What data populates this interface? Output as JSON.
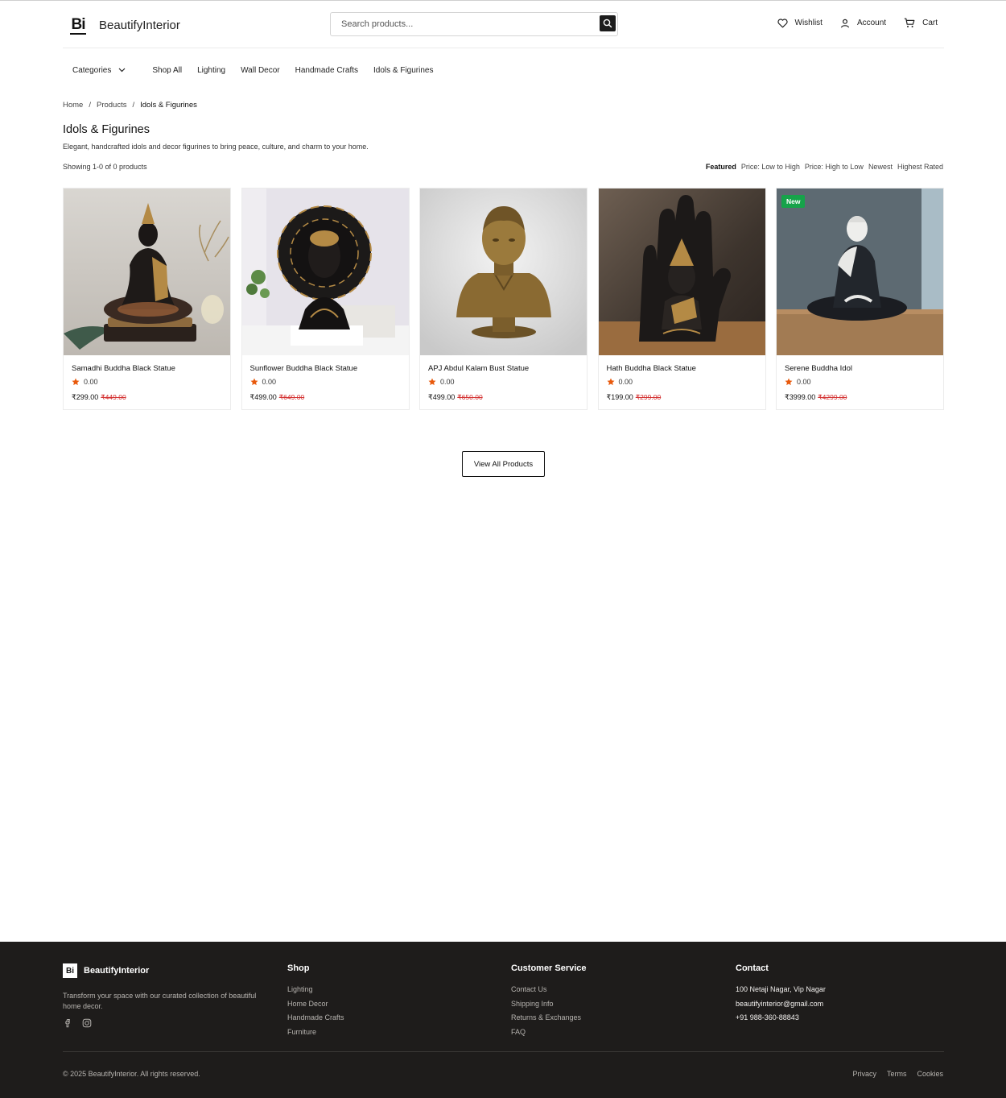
{
  "header": {
    "logo_mark": "Bi",
    "brand": "BeautifyInterior",
    "search_placeholder": "Search products...",
    "wishlist": "Wishlist",
    "account": "Account",
    "cart": "Cart"
  },
  "nav": {
    "categories": "Categories",
    "links": [
      "Shop All",
      "Lighting",
      "Wall Decor",
      "Handmade Crafts",
      "Idols & Figurines"
    ]
  },
  "breadcrumb": {
    "home": "Home",
    "sep": "/",
    "products": "Products",
    "current": "Idols & Figurines"
  },
  "page": {
    "title": "Idols & Figurines",
    "description": "Elegant, handcrafted idols and decor figurines to bring peace, culture, and charm to your home.",
    "showing": "Showing 1-0 of 0 products",
    "sort_options": [
      "Featured",
      "Price: Low to High",
      "Price: High to Low",
      "Newest",
      "Highest Rated"
    ]
  },
  "products": [
    {
      "name": "Samadhi Buddha Black Statue",
      "rating": "0.00",
      "price": "₹299.00",
      "old_price": "₹449.00",
      "badge": ""
    },
    {
      "name": "Sunflower Buddha Black Statue",
      "rating": "0.00",
      "price": "₹499.00",
      "old_price": "₹649.00",
      "badge": ""
    },
    {
      "name": "APJ Abdul Kalam Bust Statue",
      "rating": "0.00",
      "price": "₹499.00",
      "old_price": "₹650.00",
      "badge": ""
    },
    {
      "name": "Hath Buddha Black Statue",
      "rating": "0.00",
      "price": "₹199.00",
      "old_price": "₹299.00",
      "badge": ""
    },
    {
      "name": "Serene Buddha Idol",
      "rating": "0.00",
      "price": "₹3999.00",
      "old_price": "₹4299.00",
      "badge": "New"
    }
  ],
  "view_all": "View All Products",
  "footer": {
    "logo_mark": "Bi",
    "brand": "BeautifyInterior",
    "tagline": "Transform your space with our curated collection of beautiful home decor.",
    "shop_heading": "Shop",
    "shop_links": [
      "Lighting",
      "Home Decor",
      "Handmade Crafts",
      "Furniture"
    ],
    "service_heading": "Customer Service",
    "service_links": [
      "Contact Us",
      "Shipping Info",
      "Returns & Exchanges",
      "FAQ"
    ],
    "contact_heading": "Contact",
    "contact_lines": [
      "100 Netaji Nagar, Vip Nagar",
      "beautifyinterior@gmail.com",
      "+91 988-360-88843"
    ],
    "copyright": "© 2025 BeautifyInterior. All rights reserved.",
    "legal": [
      "Privacy",
      "Terms",
      "Cookies"
    ]
  },
  "colors": {
    "accent_star": "#e8590c",
    "old_price": "#d32f2f",
    "badge_new": "#16a34a",
    "footer_bg": "#1e1c1b"
  }
}
